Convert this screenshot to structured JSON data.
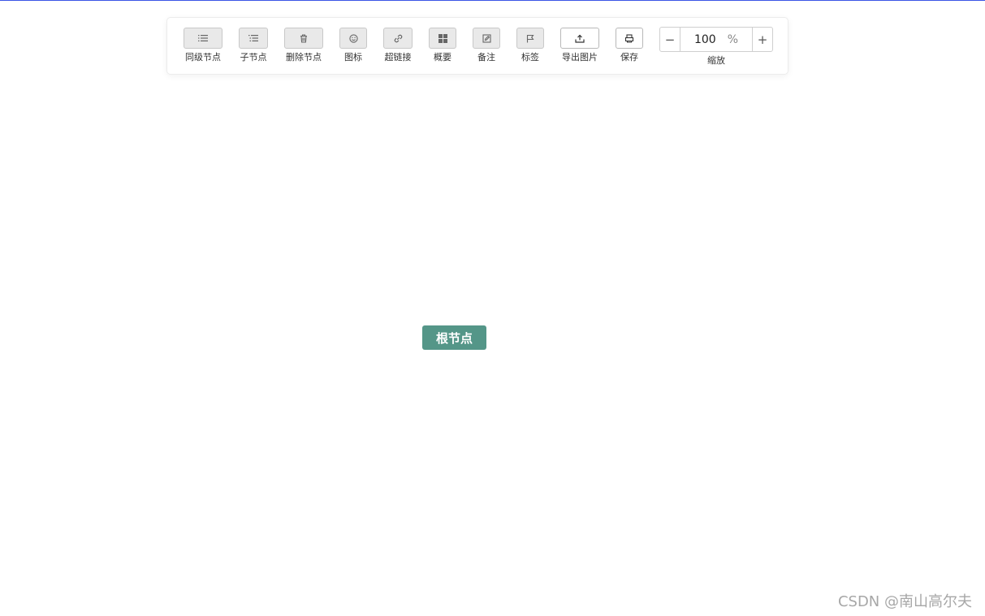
{
  "toolbar": {
    "tools": [
      {
        "key": "sibling",
        "label": "同级节点",
        "icon": "list-icon",
        "enabled": false
      },
      {
        "key": "child",
        "label": "子节点",
        "icon": "indent-list-icon",
        "enabled": false
      },
      {
        "key": "delete",
        "label": "删除节点",
        "icon": "trash-icon",
        "enabled": false
      },
      {
        "key": "icon",
        "label": "图标",
        "icon": "smiley-icon",
        "enabled": false
      },
      {
        "key": "link",
        "label": "超链接",
        "icon": "link-icon",
        "enabled": false
      },
      {
        "key": "summary",
        "label": "概要",
        "icon": "grid-icon",
        "enabled": false
      },
      {
        "key": "note",
        "label": "备注",
        "icon": "edit-icon",
        "enabled": false
      },
      {
        "key": "tag",
        "label": "标签",
        "icon": "flag-icon",
        "enabled": false
      },
      {
        "key": "export",
        "label": "导出图片",
        "icon": "upload-icon",
        "enabled": true
      },
      {
        "key": "save",
        "label": "保存",
        "icon": "printer-icon",
        "enabled": true
      }
    ],
    "zoom": {
      "value": "100",
      "unit": "%",
      "minus": "−",
      "plus": "+",
      "label": "缩放"
    }
  },
  "canvas": {
    "root_node_label": "根节点"
  },
  "watermark": "CSDN @南山高尔夫",
  "colors": {
    "root_node_bg": "#549688",
    "top_line": "#3b55e6"
  }
}
